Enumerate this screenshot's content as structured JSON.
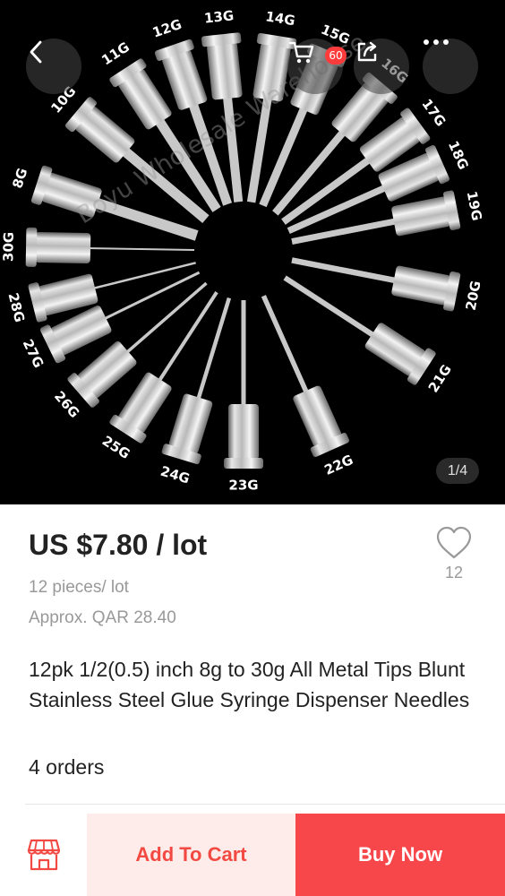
{
  "gallery": {
    "gauge_labels": [
      "8G",
      "10G",
      "11G",
      "12G",
      "13G",
      "14G",
      "15G",
      "16G",
      "17G",
      "18G",
      "19G",
      "20G",
      "21G",
      "22G",
      "23G",
      "24G",
      "25G",
      "26G",
      "27G",
      "28G",
      "30G"
    ],
    "watermark": "Boyu Wholesale Warehouse",
    "cart_count": "60",
    "page_indicator": "1/4",
    "icons": {
      "back": "chevron-left-icon",
      "cart": "cart-icon",
      "share": "share-icon",
      "more": "more-icon"
    }
  },
  "product": {
    "price": "US $7.80 / lot",
    "unit": "12 pieces/ lot",
    "approx_price": "Approx. QAR 28.40",
    "title": "12pk 1/2(0.5) inch 8g to 30g All Metal Tips Blunt Stainless Steel Glue Syringe Dispenser Needles",
    "orders": "4 orders",
    "wishlist_count": "12"
  },
  "actions": {
    "store_icon": "store-icon",
    "add_to_cart": "Add To Cart",
    "buy_now": "Buy Now"
  },
  "colors": {
    "accent": "#f8474a",
    "accent_light": "#fdece9",
    "accent_text": "#f24a43",
    "badge": "#ff3b3b"
  }
}
